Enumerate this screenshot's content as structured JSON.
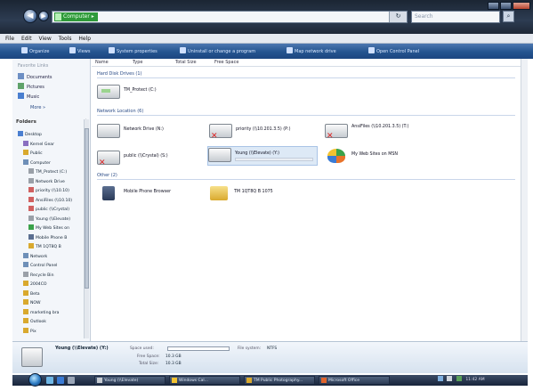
{
  "window": {
    "address_path": "Computer",
    "search_placeholder": "Search"
  },
  "menu": [
    "File",
    "Edit",
    "View",
    "Tools",
    "Help"
  ],
  "toolbar": [
    "Organize",
    "Views",
    "System properties",
    "Uninstall or change a program",
    "Map network drive",
    "Open Control Panel"
  ],
  "favorites": {
    "title": "Favorite Links",
    "items": [
      "Documents",
      "Pictures",
      "Music"
    ],
    "more": "More »"
  },
  "folders": {
    "header": "Folders",
    "tree": [
      "Desktop",
      "Kernel Gear",
      "Public",
      "Computer",
      "TM_Protect (C:)",
      "Network Drive",
      "priority (\\\\10.10)",
      "AnsiFiles (\\\\10.10)",
      "public (\\\\Crystal)",
      "Young (\\\\Elevate)",
      "My Web Sites on",
      "Mobile Phone B",
      "TM 1QT8Q B",
      "Network",
      "Control Panel",
      "Recycle Bin",
      "2004CO",
      "Beta",
      "NOW",
      "marketing bra",
      "Outlook",
      "Pix"
    ]
  },
  "columns": [
    "Name",
    "Type",
    "Total Size",
    "Free Space"
  ],
  "groups": {
    "hard_disk": "Hard Disk Drives (1)",
    "network": "Network Location (6)",
    "other": "Other (2)"
  },
  "items": {
    "drive_c": "TM_Protect (C:)",
    "net_drive": "Network Drive (N:)",
    "priority": "priority (\\\\10.201.3.5) (P:)",
    "ansifiles": "AnsiFiles (\\\\10.201.3.5) (T:)",
    "public": "public (\\\\Crystal) (S:)",
    "young": "Young (\\\\Elevate) (Y:)",
    "young_sub": "",
    "mywebsites": "My Web Sites on MSN",
    "mobile": "Mobile Phone Browser",
    "tm": "TM 1QT8Q B 1075"
  },
  "details": {
    "name": "Young (\\\\Elevate) (Y:)",
    "space_used_label": "Space used:",
    "free_space_label": "Free Space:",
    "free_space_value": "10.3 GB",
    "total_size_label": "Total Size:",
    "total_size_value": "10.3 GB",
    "fs_label": "File system:",
    "fs_value": "NTFS"
  },
  "taskbar": {
    "tasks": [
      "Young (\\\\Elevate)",
      "Windows Cal...",
      "TM Public Photography...",
      "Microsoft Office"
    ],
    "clock": "11:42 AM"
  },
  "colors": {
    "toolbar": "#24548f",
    "group_header": "#2a4b86",
    "selection": "#dde9f6",
    "address_crumb": "#2f9a3a"
  }
}
